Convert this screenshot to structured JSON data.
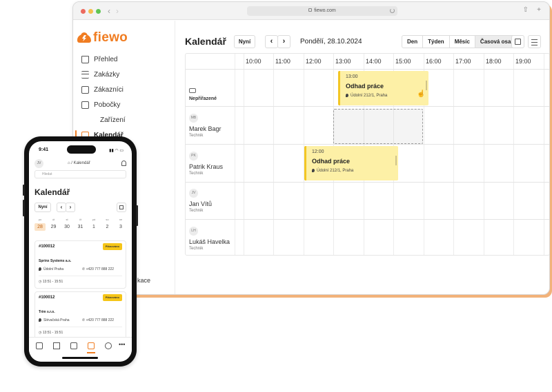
{
  "browser": {
    "url": "fiewo.com"
  },
  "app": {
    "logo_text": "fiewo",
    "accent_color": "#f07d22"
  },
  "sidebar": {
    "items": [
      {
        "label": "Přehled",
        "icon": "home-icon"
      },
      {
        "label": "Zakázky",
        "icon": "list-icon"
      },
      {
        "label": "Zákazníci",
        "icon": "contact-card-icon"
      },
      {
        "label": "Pobočky",
        "icon": "building-icon"
      },
      {
        "label": "Zařízení",
        "icon": "phone-icon"
      },
      {
        "label": "Kalendář",
        "icon": "calendar-icon",
        "active": true
      }
    ],
    "partial_item": "kace"
  },
  "calendar": {
    "title": "Kalendář",
    "now_label": "Nyní",
    "prev": "‹",
    "next": "›",
    "date": "Pondělí, 28.10.2024",
    "views": [
      "Den",
      "Týden",
      "Měsíc",
      "Časová osa"
    ],
    "active_view": "Časová osa",
    "hours": [
      "10:00",
      "11:00",
      "12:00",
      "13:00",
      "14:00",
      "15:00",
      "16:00",
      "17:00",
      "18:00",
      "19:00"
    ],
    "unassigned_label": "Nepřiřazené",
    "people": [
      {
        "initials": "MB",
        "name": "Marek Bagr",
        "role": "Technik"
      },
      {
        "initials": "PK",
        "name": "Patrik Kraus",
        "role": "Technik"
      },
      {
        "initials": "JV",
        "name": "Jan Vítů",
        "role": "Technik"
      },
      {
        "initials": "LH",
        "name": "Lukáš Havelka",
        "role": "Technik"
      }
    ],
    "events": [
      {
        "time": "13:00",
        "title": "Odhad práce",
        "address": "Údolní 212/1, Praha",
        "row": "Nepřiřazené"
      },
      {
        "time": "12:00",
        "title": "Odhad práce",
        "address": "Údolní 212/1, Praha",
        "row": "Patrik Kraus"
      }
    ]
  },
  "phone": {
    "time": "9:41",
    "avatar": "JV",
    "breadcrumb": "/ Kalendář",
    "search_placeholder": "Hledat",
    "title": "Kalendář",
    "now_label": "Nyní",
    "prev": "‹",
    "next": "›",
    "days": [
      {
        "name": "po",
        "date": "28",
        "selected": true
      },
      {
        "name": "út",
        "date": "29"
      },
      {
        "name": "st",
        "date": "30"
      },
      {
        "name": "čt",
        "date": "31"
      },
      {
        "name": "pá",
        "date": "1"
      },
      {
        "name": "so",
        "date": "2"
      },
      {
        "name": "ne",
        "date": "3"
      }
    ],
    "cards": [
      {
        "id": "#100012",
        "status": "Plánováno",
        "company": "Sprinx Systems a.s.",
        "address": "Údolní Praha",
        "phone": "+420 777 888 222",
        "time": "13:51 - 15:51"
      },
      {
        "id": "#100012",
        "status": "Plánováno",
        "company": "Trim s.r.o.",
        "address": "Slévačská Praha",
        "phone": "+420 777 888 222",
        "time": "13:51 - 15:51"
      }
    ],
    "more": "•••"
  }
}
